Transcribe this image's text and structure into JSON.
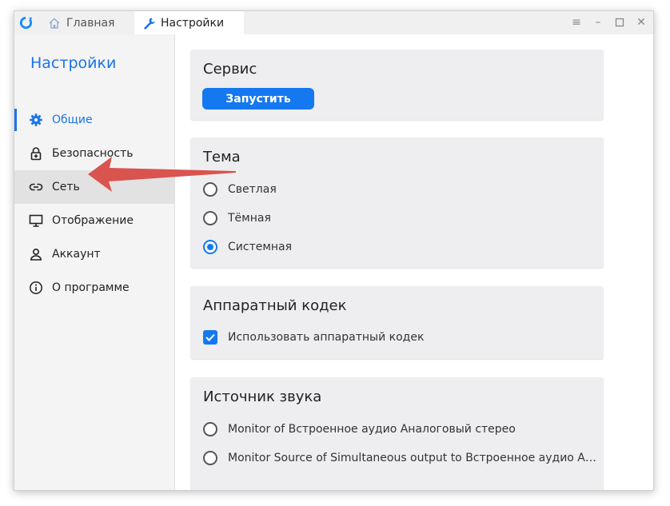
{
  "titlebar": {
    "tabs": [
      {
        "label": "Главная",
        "icon": "home-icon"
      },
      {
        "label": "Настройки",
        "icon": "wrench-icon"
      }
    ],
    "buttons": [
      "menu-icon",
      "minimize-icon",
      "maximize-icon",
      "close-icon"
    ]
  },
  "sidebar": {
    "title": "Настройки",
    "items": [
      {
        "label": "Общие",
        "icon": "gear-icon",
        "active": true
      },
      {
        "label": "Безопасность",
        "icon": "lock-icon"
      },
      {
        "label": "Сеть",
        "icon": "link-icon",
        "hovered": true
      },
      {
        "label": "Отображение",
        "icon": "monitor-icon"
      },
      {
        "label": "Аккаунт",
        "icon": "user-icon"
      },
      {
        "label": "О программе",
        "icon": "info-icon"
      }
    ]
  },
  "main": {
    "service": {
      "title": "Сервис",
      "button": "Запустить"
    },
    "theme": {
      "title": "Тема",
      "options": [
        "Светлая",
        "Тёмная",
        "Системная"
      ],
      "selected": "Системная"
    },
    "codec": {
      "title": "Аппаратный кодек",
      "checkbox_label": "Использовать аппаратный кодек",
      "checked": true
    },
    "audio": {
      "title": "Источник звука",
      "options": [
        "Monitor of Встроенное аудио Аналоговый стерео",
        "Monitor Source of Simultaneous output to Встроенное аудио А…"
      ]
    }
  },
  "colors": {
    "accent": "#1478f0",
    "arrow": "#d9534f",
    "sidebar_bg": "#f4f4f4",
    "card_bg": "#eeeef0"
  }
}
